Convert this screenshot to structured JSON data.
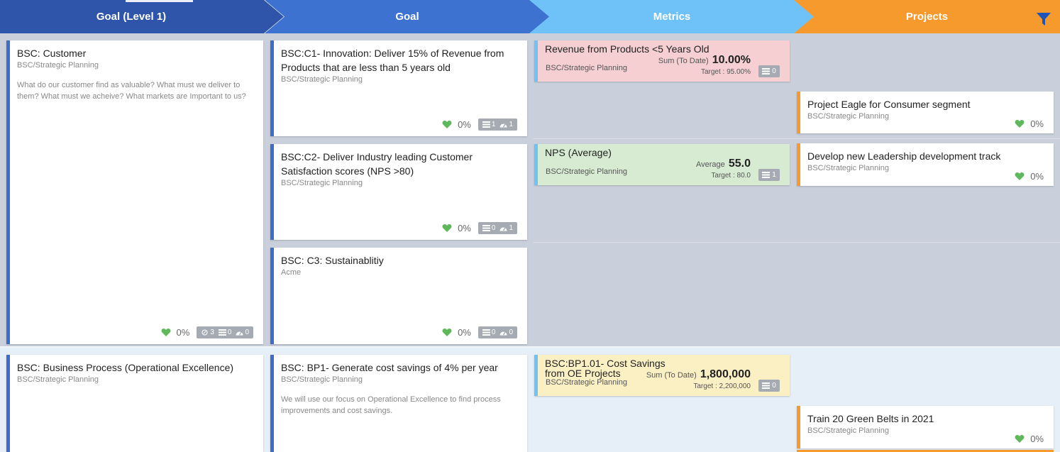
{
  "header": {
    "goal_level1": "Goal (Level 1)",
    "goal": "Goal",
    "metrics": "Metrics",
    "projects": "Projects",
    "filter_icon": "filter-icon"
  },
  "colors": {
    "goal_level1": "#2e55a9",
    "goal": "#3d72d0",
    "metrics": "#6fc2f7",
    "projects": "#f79a2d",
    "metric_red": "#f5cfd1",
    "metric_green": "#d6ebd2",
    "metric_yellow": "#fbefc4",
    "heart": "#5fb85b"
  },
  "level1_goals": [
    {
      "title": "BSC: Customer",
      "org": "BSC/Strategic Planning",
      "description": "What do our customer find as valuable? What must we deliver to them? What must we acheive? What markets are Important to us?",
      "progress": "0%",
      "badges": [
        "3",
        "0",
        "0"
      ]
    },
    {
      "title": "BSC: Business Process (Operational Excellence)",
      "org": "BSC/Strategic Planning"
    }
  ],
  "goals": [
    {
      "title": "BSC:C1- Innovation: Deliver 15% of Revenue from Products that are less than 5 years old",
      "org": "BSC/Strategic Planning",
      "progress": "0%",
      "badges": [
        "1",
        "1"
      ]
    },
    {
      "title": "BSC:C2- Deliver Industry leading Customer Satisfaction scores (NPS >80)",
      "org": "BSC/Strategic Planning",
      "progress": "0%",
      "badges": [
        "0",
        "1"
      ]
    },
    {
      "title": "BSC: C3: Sustainablitiy",
      "org": "Acme",
      "progress": "0%",
      "badges": [
        "0",
        "0"
      ]
    },
    {
      "title": "BSC: BP1- Generate cost savings of 4% per year",
      "org": "BSC/Strategic Planning",
      "description": "We will use our focus on Operational Excellence to find process improvements and cost savings."
    }
  ],
  "metrics": [
    {
      "title": "Revenue from Products <5 Years Old",
      "org": "BSC/Strategic Planning",
      "stat_label": "Sum (To Date)",
      "stat_value": "10.00%",
      "target": "Target : 95.00%",
      "badge": "0"
    },
    {
      "title": "NPS (Average)",
      "org": "BSC/Strategic Planning",
      "stat_label": "Average",
      "stat_value": "55.0",
      "target": "Target : 80.0",
      "badge": "1"
    },
    {
      "title": "BSC:BP1.01- Cost Savings from OE Projects",
      "org": "BSC/Strategic Planning",
      "stat_label": "Sum (To Date)",
      "stat_value": "1,800,000",
      "target": "Target : 2,200,000",
      "badge": "0"
    }
  ],
  "projects": [
    {
      "title": "Project Eagle for Consumer segment",
      "org": "BSC/Strategic Planning",
      "progress": "0%"
    },
    {
      "title": "Develop new Leadership development track",
      "org": "BSC/Strategic Planning",
      "progress": "0%"
    },
    {
      "title": "Train 20 Green Belts in 2021",
      "org": "BSC/Strategic Planning",
      "progress": "0%"
    }
  ]
}
